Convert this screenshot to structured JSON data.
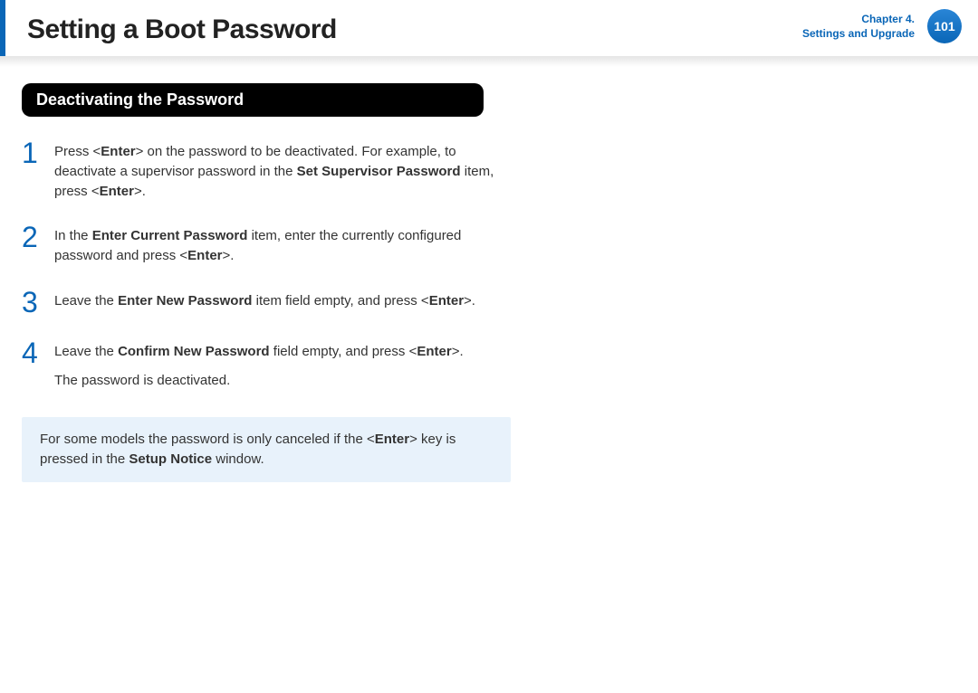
{
  "header": {
    "title": "Setting a Boot Password",
    "chapter_line1": "Chapter 4.",
    "chapter_line2": "Settings and Upgrade",
    "page_number": "101"
  },
  "section": {
    "title": "Deactivating the Password"
  },
  "steps": [
    {
      "num": "1",
      "html": "Press &lt;<b>Enter</b>&gt; on the password to be deactivated. For example, to deactivate a supervisor password in the <b>Set Supervisor Password</b> item, press &lt;<b>Enter</b>&gt;."
    },
    {
      "num": "2",
      "html": "In the <b>Enter Current Password</b> item, enter the currently configured password and press &lt;<b>Enter</b>&gt;."
    },
    {
      "num": "3",
      "html": "Leave the <b>Enter New Password</b> item field empty, and press &lt;<b>Enter</b>&gt;."
    },
    {
      "num": "4",
      "html": "Leave the <b>Confirm New Password</b> field empty, and press &lt;<b>Enter</b>&gt;.",
      "extra": "The password is deactivated."
    }
  ],
  "note": {
    "html": "For some models the password is only canceled if the &lt;<b>Enter</b>&gt; key is pressed in the <b>Setup Notice</b> window."
  }
}
